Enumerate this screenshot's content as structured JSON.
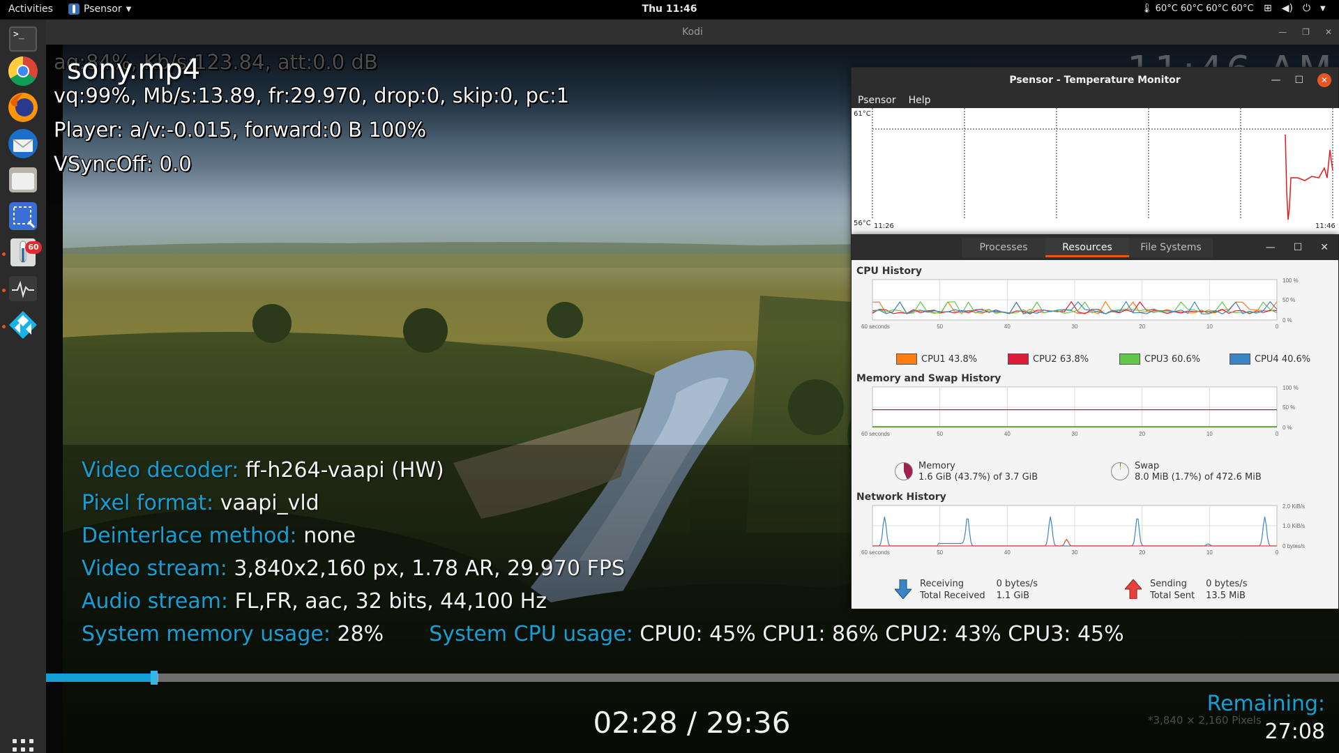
{
  "topbar": {
    "activities": "Activities",
    "app_name": "Psensor",
    "clock": "Thu 11:46",
    "temps": "60°C 60°C 60°C 60°C"
  },
  "dock": {
    "items": [
      "terminal",
      "chrome",
      "firefox",
      "thunderbird",
      "files",
      "screenshot",
      "psensor",
      "system-monitor",
      "kodi"
    ],
    "psensor_badge": "60"
  },
  "kodi": {
    "window_title": "Kodi",
    "file_title": "sony.mp4",
    "debug_audio": "aq:84%, Kb/s:123.84, att:0.0 dB",
    "debug_video": "vq:99%, Mb/s:13.89, fr:29.970, drop:0, skip:0, pc:1",
    "debug_player": "Player: a/v:-0.015,  forward:0 B 100%",
    "debug_vsync": "VSyncOff: 0.0",
    "big_clock": "11:46 AM",
    "info": {
      "decoder_label": "Video decoder:",
      "decoder_value": "ff-h264-vaapi (HW)",
      "pixel_label": "Pixel format:",
      "pixel_value": "vaapi_vld",
      "deint_label": "Deinterlace method:",
      "deint_value": "none",
      "vstream_label": "Video stream:",
      "vstream_value": "3,840x2,160 px, 1.78 AR, 29.970 FPS",
      "astream_label": "Audio stream:",
      "astream_value": "FL,FR, aac, 32 bits, 44,100 Hz",
      "mem_label": "System memory usage:",
      "mem_value": "28%",
      "cpu_label": "System CPU usage:",
      "cpu_value": "CPU0:  45% CPU1:  86% CPU2:  43% CPU3:  45%"
    },
    "playback": {
      "position_fraction": 0.0834,
      "cache_fraction": 0.087,
      "time": "02:28 / 29:36",
      "remaining_label": "Remaining:",
      "remaining_value": "27:08",
      "pixel_hint": "*3,840 × 2,160 Pixels"
    }
  },
  "psensor": {
    "title": "Psensor - Temperature Monitor",
    "menu": [
      "Psensor",
      "Help"
    ],
    "y_max": "61°C",
    "y_min": "56°C",
    "x_start": "11:26",
    "x_end": "11:46"
  },
  "sysmon": {
    "tabs": [
      "Processes",
      "Resources",
      "File Systems"
    ],
    "active_tab": "Resources",
    "cpu": {
      "title": "CPU History",
      "axis": [
        "60 seconds",
        "50",
        "40",
        "30",
        "20",
        "10",
        "0"
      ],
      "y_labels": [
        "100 %",
        "50 %",
        "0 %"
      ],
      "legend": [
        {
          "label": "CPU1",
          "value": "43.8%",
          "color": "#fc7e13"
        },
        {
          "label": "CPU2",
          "value": "63.8%",
          "color": "#dd1b3a"
        },
        {
          "label": "CPU3",
          "value": "60.6%",
          "color": "#63c64b"
        },
        {
          "label": "CPU4",
          "value": "40.6%",
          "color": "#3b85c4"
        }
      ]
    },
    "memory": {
      "title": "Memory and Swap History",
      "axis": [
        "60 seconds",
        "50",
        "40",
        "30",
        "20",
        "10",
        "0"
      ],
      "y_labels": [
        "100 %",
        "50 %",
        "0 %"
      ],
      "mem_label": "Memory",
      "mem_value": "1.6 GiB (43.7%) of 3.7 GiB",
      "swap_label": "Swap",
      "swap_value": "8.0 MiB (1.7%) of 472.6 MiB",
      "mem_color": "#a02150",
      "swap_color": "#4e9a06"
    },
    "network": {
      "title": "Network History",
      "axis": [
        "60 seconds",
        "50",
        "40",
        "30",
        "20",
        "10",
        "0"
      ],
      "y_labels": [
        "2.0 KiB/s",
        "1.0 KiB/s",
        "0 bytes/s"
      ],
      "recv_label": "Receiving",
      "recv_value": "0 bytes/s",
      "recv_total_label": "Total Received",
      "recv_total_value": "1.1 GiB",
      "send_label": "Sending",
      "send_value": "0 bytes/s",
      "send_total_label": "Total Sent",
      "send_total_value": "13.5 MiB",
      "recv_color": "#3b85c4",
      "send_color": "#e8413a"
    }
  }
}
